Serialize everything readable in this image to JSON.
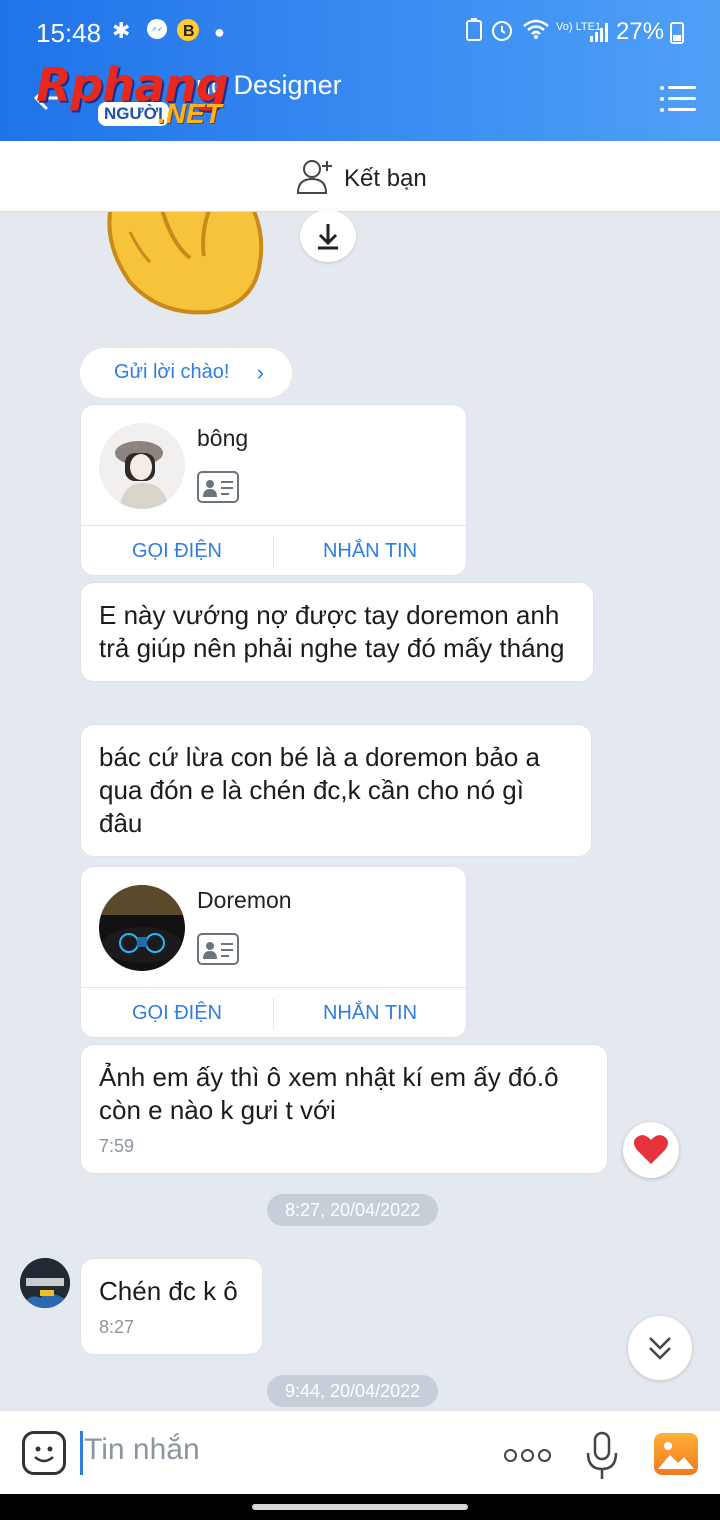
{
  "status_bar": {
    "time": "15:48",
    "battery": "27%",
    "icons": [
      "slack-icon",
      "messenger-icon",
      "b-icon",
      "dot-icon",
      "battery-saver-icon",
      "alarm-icon",
      "wifi-icon",
      "volte-icon",
      "signal-icon",
      "battery-icon"
    ],
    "network": "Vo) LTE1"
  },
  "header": {
    "title": "ng Designer",
    "watermark": {
      "word": "Rphang",
      "tag": "NGƯỜI",
      "net": ".NET"
    }
  },
  "friend_bar": {
    "label": "Kết bạn"
  },
  "greet_chip": {
    "label": "Gửi lời chào!"
  },
  "contact_cards": [
    {
      "name": "bông",
      "call_label": "GỌI ĐIỆN",
      "message_label": "NHẮN TIN"
    },
    {
      "name": "Doremon",
      "call_label": "GỌI ĐIỆN",
      "message_label": "NHẮN TIN"
    }
  ],
  "messages": [
    {
      "text": "E này vướng nợ được tay doremon anh trả giúp nên phải nghe tay đó mấy tháng"
    },
    {
      "text": "bác cứ lừa con bé là a doremon bảo a qua đón e là chén đc,k cần cho nó gì đâu"
    },
    {
      "text": "Ảnh em ấy thì ô xem nhật kí em ấy đó.ô còn e nào k gưi t với",
      "time": "7:59"
    },
    {
      "text": "Chén đc k ô",
      "time": "8:27"
    }
  ],
  "date_separators": [
    "8:27, 20/04/2022",
    "9:44, 20/04/2022"
  ],
  "input_bar": {
    "placeholder": "Tin nhắn"
  },
  "colors": {
    "accent": "#2f7de0",
    "header_start": "#1f73e8",
    "header_end": "#4ea0f6",
    "background": "#e4e9f0",
    "reaction": "#e5323c"
  }
}
